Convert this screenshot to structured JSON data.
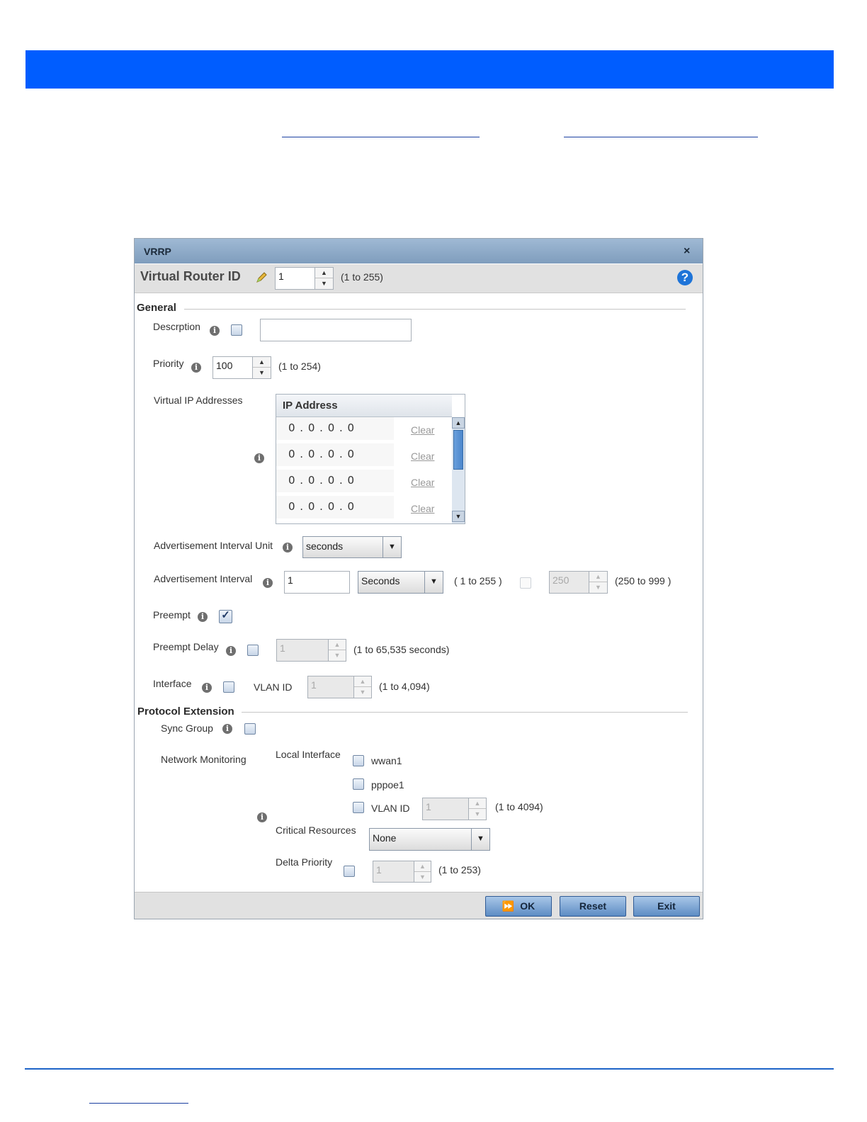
{
  "dialog": {
    "title": "VRRP",
    "close": "×",
    "virtual_router_label": "Virtual Router ID",
    "virtual_router_value": "1",
    "virtual_router_range": "(1 to 255)",
    "help": "?"
  },
  "general": {
    "section_title": "General",
    "description_label": "Descrption",
    "description_value": "",
    "priority_label": "Priority",
    "priority_value": "100",
    "priority_range": "(1 to 254)",
    "vip_label": "Virtual IP Addresses",
    "ip_header": "IP Address",
    "ip_rows": [
      {
        "ip": "0 . 0 . 0 . 0",
        "clear": "Clear"
      },
      {
        "ip": "0 . 0 . 0 . 0",
        "clear": "Clear"
      },
      {
        "ip": "0 . 0 . 0 . 0",
        "clear": "Clear"
      },
      {
        "ip": "0 . 0 . 0 . 0",
        "clear": "Clear"
      }
    ],
    "adv_unit_label": "Advertisement Interval Unit",
    "adv_unit_value": "seconds",
    "adv_interval_label": "Advertisement Interval",
    "adv_interval_value": "1",
    "adv_interval_unit": "Seconds",
    "adv_interval_range": "( 1 to 255 )",
    "adv_ms_value": "250",
    "adv_ms_range": "(250 to 999 )",
    "preempt_label": "Preempt",
    "preempt_checked": "✓",
    "preempt_delay_label": "Preempt Delay",
    "preempt_delay_value": "1",
    "preempt_delay_range": "(1 to 65,535 seconds)",
    "interface_label": "Interface",
    "vlan_label": "VLAN ID",
    "vlan_value": "1",
    "vlan_range": "(1 to 4,094)"
  },
  "protocol_extension": {
    "section_title": "Protocol Extension",
    "sync_group_label": "Sync Group",
    "network_monitoring_label": "Network Monitoring",
    "local_interface_label": "Local Interface",
    "wwan_label": "wwan1",
    "pppoe_label": "pppoe1",
    "vlan_label": "VLAN ID",
    "vlan_value": "1",
    "vlan_range": "(1 to 4094)",
    "critical_resources_label": "Critical Resources",
    "critical_resources_value": "None",
    "delta_priority_label": "Delta Priority",
    "delta_priority_value": "1",
    "delta_priority_range": "(1 to 253)"
  },
  "footer": {
    "ok": "OK",
    "reset": "Reset",
    "exit": "Exit"
  },
  "colors": {
    "top_bar": "#005dff",
    "title_bar": "#8fabca",
    "button": "#6f9bd0"
  },
  "icons": [
    "pencil-icon",
    "help-icon",
    "info-icon",
    "dropdown-arrow-icon",
    "ok-arrow-icon",
    "close-icon"
  ]
}
